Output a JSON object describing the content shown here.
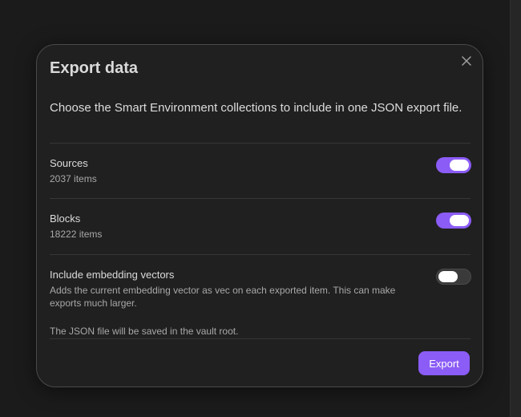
{
  "modal": {
    "title": "Export data",
    "description": "Choose the Smart Environment collections to include in one JSON export file.",
    "close_icon": "close-icon",
    "settings": [
      {
        "name": "Sources",
        "desc": "2037 items",
        "enabled": true
      },
      {
        "name": "Blocks",
        "desc": "18222 items",
        "enabled": true
      },
      {
        "name": "Include embedding vectors",
        "desc": "Adds the current embedding vector as vec on each exported item. This can make exports much larger.",
        "enabled": false
      }
    ],
    "note": "The JSON file will be saved in the vault root.",
    "export_label": "Export"
  },
  "colors": {
    "accent": "#8b5cf6",
    "background": "#202020",
    "toggle_off": "#3a3a3a"
  }
}
